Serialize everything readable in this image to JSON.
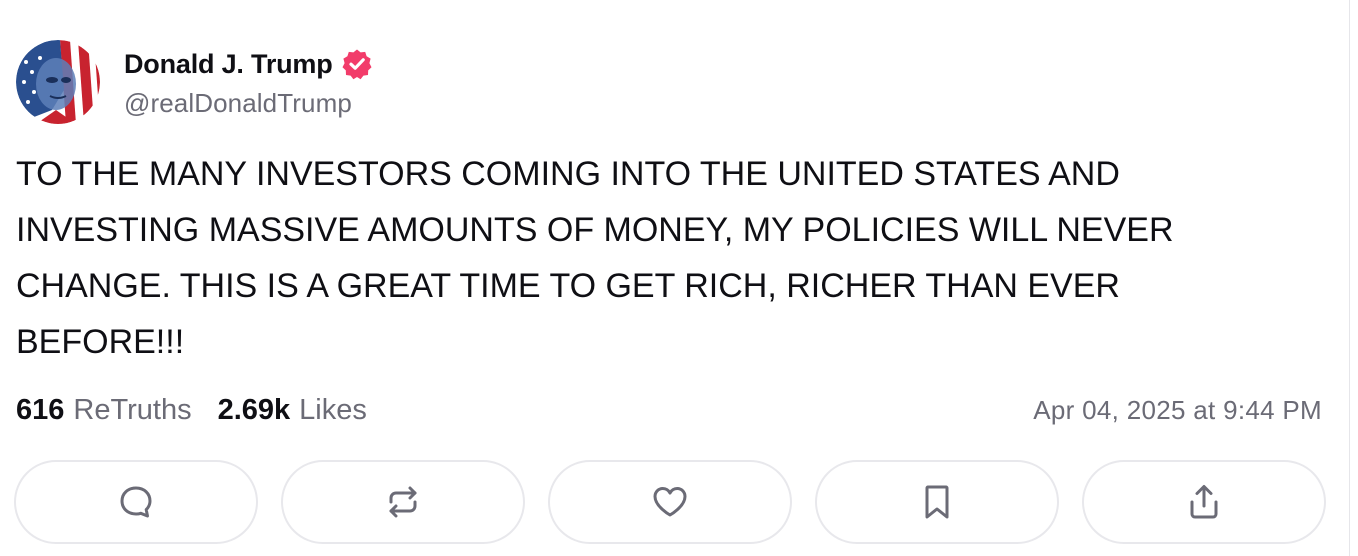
{
  "author": {
    "display_name": "Donald J. Trump",
    "handle": "@realDonaldTrump",
    "verified": true
  },
  "post": {
    "text": "TO THE MANY INVESTORS COMING INTO THE UNITED STATES AND\nINVESTING MASSIVE AMOUNTS OF MONEY, MY POLICIES WILL NEVER\nCHANGE. THIS IS A GREAT TIME TO GET RICH, RICHER THAN EVER\nBEFORE!!!",
    "retruths_count": "616",
    "retruths_label": "ReTruths",
    "likes_count": "2.69k",
    "likes_label": "Likes",
    "timestamp": "Apr 04, 2025 at 9:44 PM"
  },
  "actions": [
    {
      "icon": "reply-icon"
    },
    {
      "icon": "retruth-icon"
    },
    {
      "icon": "heart-icon"
    },
    {
      "icon": "bookmark-icon"
    },
    {
      "icon": "share-icon"
    }
  ],
  "colors": {
    "verified_badge": "#f23c6a",
    "muted_text": "#6b6b76",
    "icon_gray": "#6b6b76",
    "button_border": "#e8e8ec"
  }
}
